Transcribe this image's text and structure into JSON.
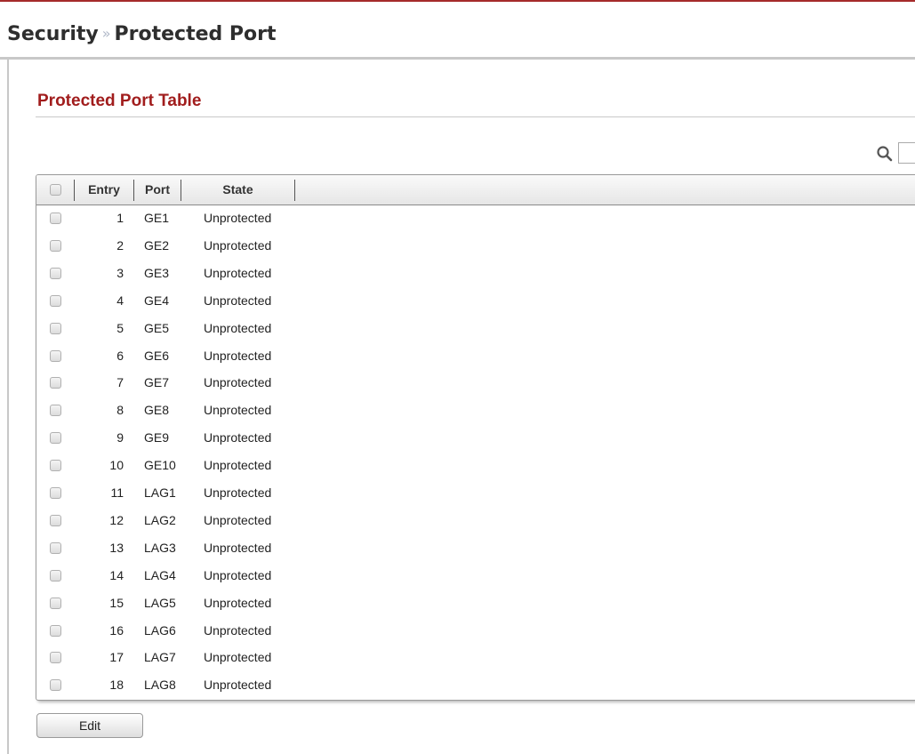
{
  "breadcrumb": {
    "section": "Security",
    "separator": "»",
    "page": "Protected Port"
  },
  "panel": {
    "title": "Protected Port Table"
  },
  "search": {
    "icon": "search-icon",
    "value": ""
  },
  "table": {
    "columns": [
      "Entry",
      "Port",
      "State"
    ],
    "rows": [
      {
        "entry": "1",
        "port": "GE1",
        "state": "Unprotected"
      },
      {
        "entry": "2",
        "port": "GE2",
        "state": "Unprotected"
      },
      {
        "entry": "3",
        "port": "GE3",
        "state": "Unprotected"
      },
      {
        "entry": "4",
        "port": "GE4",
        "state": "Unprotected"
      },
      {
        "entry": "5",
        "port": "GE5",
        "state": "Unprotected"
      },
      {
        "entry": "6",
        "port": "GE6",
        "state": "Unprotected"
      },
      {
        "entry": "7",
        "port": "GE7",
        "state": "Unprotected"
      },
      {
        "entry": "8",
        "port": "GE8",
        "state": "Unprotected"
      },
      {
        "entry": "9",
        "port": "GE9",
        "state": "Unprotected"
      },
      {
        "entry": "10",
        "port": "GE10",
        "state": "Unprotected"
      },
      {
        "entry": "11",
        "port": "LAG1",
        "state": "Unprotected"
      },
      {
        "entry": "12",
        "port": "LAG2",
        "state": "Unprotected"
      },
      {
        "entry": "13",
        "port": "LAG3",
        "state": "Unprotected"
      },
      {
        "entry": "14",
        "port": "LAG4",
        "state": "Unprotected"
      },
      {
        "entry": "15",
        "port": "LAG5",
        "state": "Unprotected"
      },
      {
        "entry": "16",
        "port": "LAG6",
        "state": "Unprotected"
      },
      {
        "entry": "17",
        "port": "LAG7",
        "state": "Unprotected"
      },
      {
        "entry": "18",
        "port": "LAG8",
        "state": "Unprotected"
      }
    ]
  },
  "actions": {
    "edit_label": "Edit"
  },
  "colors": {
    "title_red": "#a11d1d",
    "top_rule": "#a52a2a",
    "frame_gray": "#c8c8c8"
  }
}
